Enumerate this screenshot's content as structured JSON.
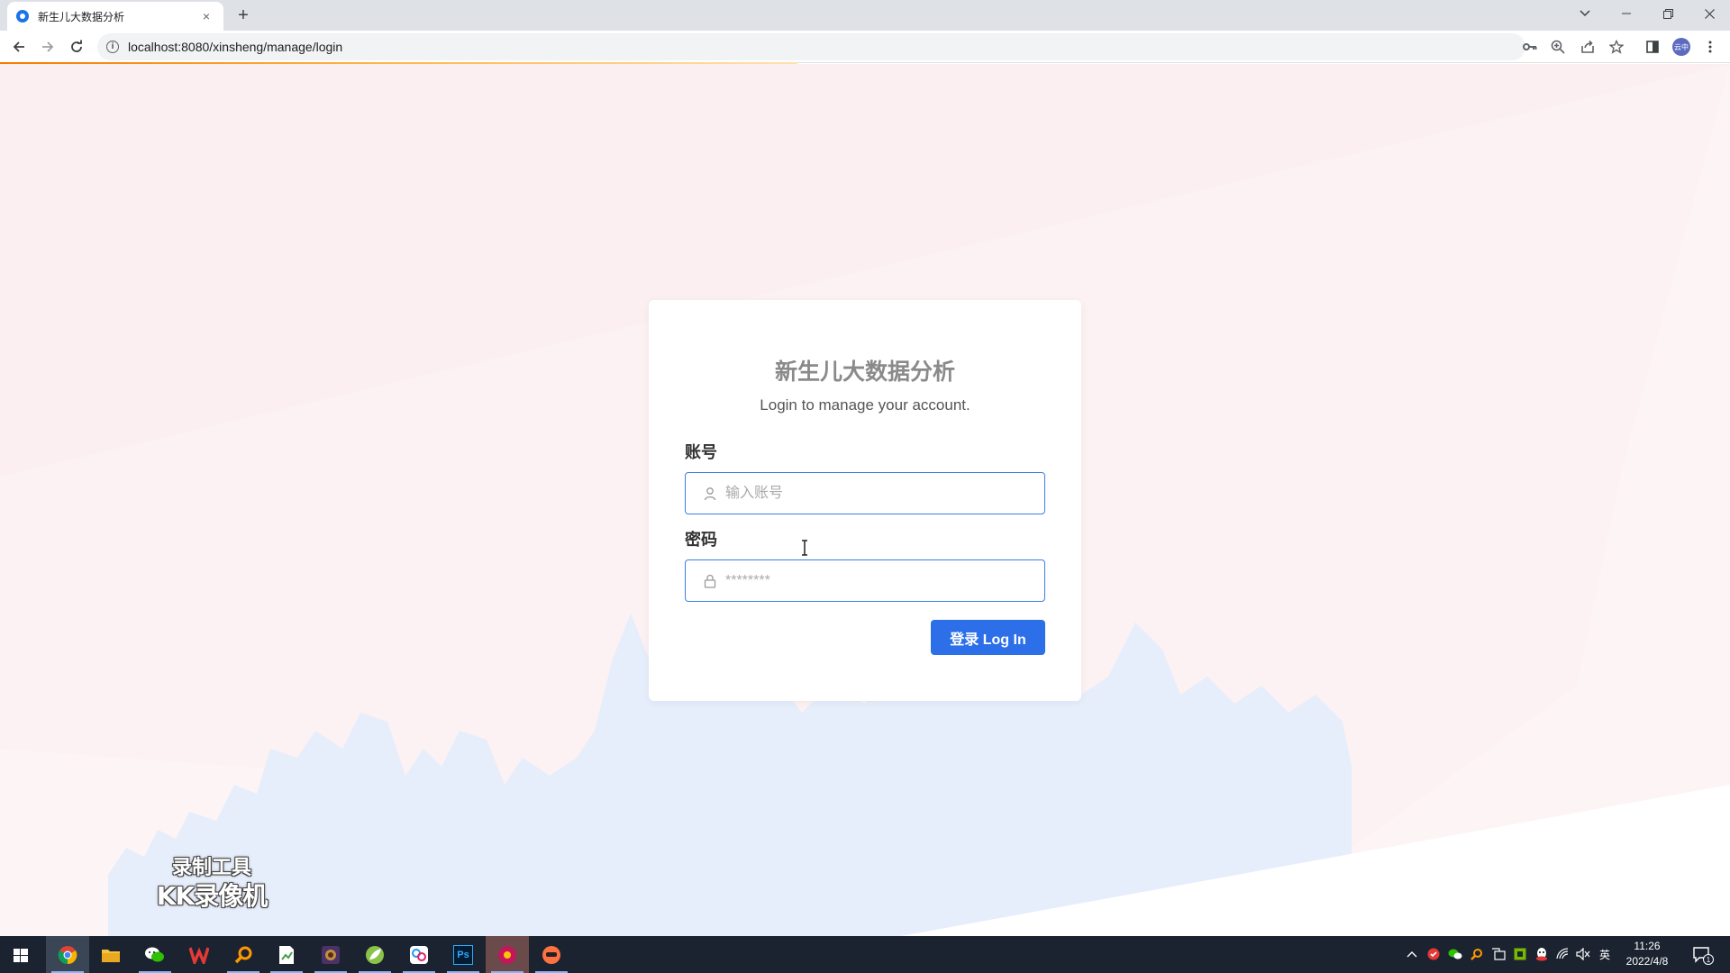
{
  "browser": {
    "tab_title": "新生儿大数据分析",
    "tab_close": "×",
    "new_tab": "+",
    "url": "localhost:8080/xinsheng/manage/login",
    "info": "i",
    "profile_label": "云中"
  },
  "login": {
    "title": "新生儿大数据分析",
    "subtitle": "Login to manage your account.",
    "account_label": "账号",
    "account_placeholder": "输入账号",
    "password_label": "密码",
    "password_placeholder": "********",
    "submit_label": "登录 Log In"
  },
  "watermark": {
    "line1": "录制工具",
    "line2": "KK录像机"
  },
  "taskbar": {
    "apps": [
      "chrome-icon",
      "file-explorer-icon",
      "wechat-icon",
      "wps-icon",
      "search-app-icon",
      "spreadsheet-icon",
      "game-icon",
      "leaf-icon",
      "network-icon",
      "photoshop-icon",
      "media-icon",
      "kk-recorder-icon"
    ],
    "ps_label": "Ps",
    "ime": "英",
    "time": "11:26",
    "date": "2022/4/8",
    "notification_count": "1"
  },
  "colors": {
    "accent": "#2d6fe8",
    "input_border": "#3c7de9",
    "page_bg": "#fcf0f1",
    "skyline": "#e6eefb"
  }
}
